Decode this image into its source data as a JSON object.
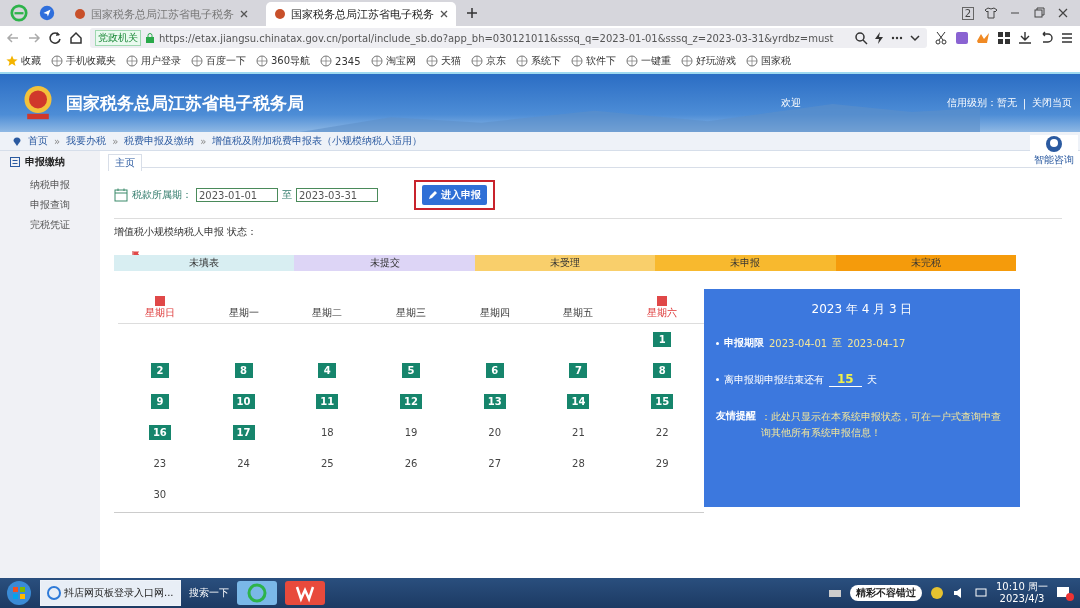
{
  "browser": {
    "tabs": [
      {
        "title": "国家税务总局江苏省电子税务",
        "selected": false
      },
      {
        "title": "国家税务总局江苏省电子税务",
        "selected": true
      }
    ],
    "tab_count": "2",
    "badge": "党政机关",
    "url": "https://etax.jiangsu.chinatax.gov.cn/portal/include_sb.do?app_bh=030121011&sssq_q=2023-01-01&sssq_z=2023-03-31&yrdbz=must",
    "bookmarks": [
      "收藏",
      "手机收藏夹",
      "用户登录",
      "百度一下",
      "360导航",
      "2345",
      "淘宝网",
      "天猫",
      "京东",
      "系统下",
      "软件下",
      "一键重",
      "好玩游戏",
      "国家税"
    ]
  },
  "site": {
    "title": "国家税务总局江苏省电子税务局",
    "welcome": "欢迎",
    "credit": "信用级别：暂无",
    "divider": "|",
    "close": "关闭当页",
    "assistant": "智能咨询"
  },
  "breadcrumb_separator": "»",
  "breadcrumb": [
    "首页",
    "我要办税",
    "税费申报及缴纳",
    "增值税及附加税费申报表（小规模纳税人适用）"
  ],
  "sidebar": {
    "title": "申报缴纳",
    "items": [
      "纳税申报",
      "申报查询",
      "完税凭证"
    ]
  },
  "page_tab": "主页",
  "form": {
    "label": "税款所属期：",
    "from": "2023-01-01",
    "sep": "至",
    "to": "2023-03-31",
    "button": "进入申报"
  },
  "status_title": "增值税小规模纳税人申报 状态：",
  "stages": [
    {
      "label": "未填表",
      "color": "#d8eef2",
      "current": true
    },
    {
      "label": "未提交",
      "color": "#ddd5f6",
      "current": false
    },
    {
      "label": "未受理",
      "color": "#f9cf6b",
      "current": false
    },
    {
      "label": "未申报",
      "color": "#f8b92e",
      "current": false
    },
    {
      "label": "未完税",
      "color": "#f59b0b",
      "current": false
    }
  ],
  "weekdays": [
    {
      "label": "星期日",
      "weekend": true
    },
    {
      "label": "星期一",
      "weekend": false
    },
    {
      "label": "星期二",
      "weekend": false
    },
    {
      "label": "星期三",
      "weekend": false
    },
    {
      "label": "星期四",
      "weekend": false
    },
    {
      "label": "星期五",
      "weekend": false
    },
    {
      "label": "星期六",
      "weekend": true
    }
  ],
  "weeks": [
    [
      {
        "kind": "blank"
      },
      {
        "kind": "blank"
      },
      {
        "kind": "blank"
      },
      {
        "kind": "blank"
      },
      {
        "kind": "blank"
      },
      {
        "kind": "blank"
      },
      {
        "kind": "day",
        "day": "1",
        "marked": true
      }
    ],
    [
      {
        "kind": "day",
        "day": "2",
        "marked": true
      },
      {
        "kind": "day",
        "day": "8",
        "marked": true
      },
      {
        "kind": "day",
        "day": "4",
        "marked": true
      },
      {
        "kind": "day",
        "day": "5",
        "marked": true
      },
      {
        "kind": "day",
        "day": "6",
        "marked": true
      },
      {
        "kind": "day",
        "day": "7",
        "marked": true
      },
      {
        "kind": "day",
        "day": "8",
        "marked": true
      }
    ],
    [
      {
        "kind": "day",
        "day": "9",
        "marked": true
      },
      {
        "kind": "day",
        "day": "10",
        "marked": true
      },
      {
        "kind": "day",
        "day": "11",
        "marked": true
      },
      {
        "kind": "day",
        "day": "12",
        "marked": true
      },
      {
        "kind": "day",
        "day": "13",
        "marked": true
      },
      {
        "kind": "day",
        "day": "14",
        "marked": true
      },
      {
        "kind": "day",
        "day": "15",
        "marked": true
      }
    ],
    [
      {
        "kind": "day",
        "day": "16",
        "marked": true
      },
      {
        "kind": "day",
        "day": "17",
        "marked": true
      },
      {
        "kind": "day",
        "day": "18",
        "marked": false
      },
      {
        "kind": "day",
        "day": "19",
        "marked": false
      },
      {
        "kind": "day",
        "day": "20",
        "marked": false
      },
      {
        "kind": "day",
        "day": "21",
        "marked": false
      },
      {
        "kind": "day",
        "day": "22",
        "marked": false
      }
    ],
    [
      {
        "kind": "day",
        "day": "23",
        "marked": false
      },
      {
        "kind": "day",
        "day": "24",
        "marked": false
      },
      {
        "kind": "day",
        "day": "25",
        "marked": false
      },
      {
        "kind": "day",
        "day": "26",
        "marked": false
      },
      {
        "kind": "day",
        "day": "27",
        "marked": false
      },
      {
        "kind": "day",
        "day": "28",
        "marked": false
      },
      {
        "kind": "day",
        "day": "29",
        "marked": false
      }
    ],
    [
      {
        "kind": "day",
        "day": "30",
        "marked": false
      },
      {
        "kind": "blank"
      },
      {
        "kind": "blank"
      },
      {
        "kind": "blank"
      },
      {
        "kind": "blank"
      },
      {
        "kind": "blank"
      },
      {
        "kind": "blank"
      }
    ]
  ],
  "panel": {
    "date": "2023 年 4 月 3 日",
    "period_label": "申报期限",
    "period_from": "2023-04-01",
    "period_sep": "至",
    "period_to": "2023-04-17",
    "remain_before": "离申报期申报结束还有",
    "remain_days": "15",
    "remain_after": "天",
    "tip_label": "友情提醒",
    "tip": "：此处只显示在本系统申报状态，可在一户式查询中查询其他所有系统申报信息！"
  },
  "taskbar": {
    "items": [
      {
        "label": "抖店网页板登录入口网...",
        "selected": true
      }
    ],
    "search": "搜索一下",
    "promo": "精彩不容错过",
    "time": "10:10 周一",
    "date": "2023/4/3"
  }
}
